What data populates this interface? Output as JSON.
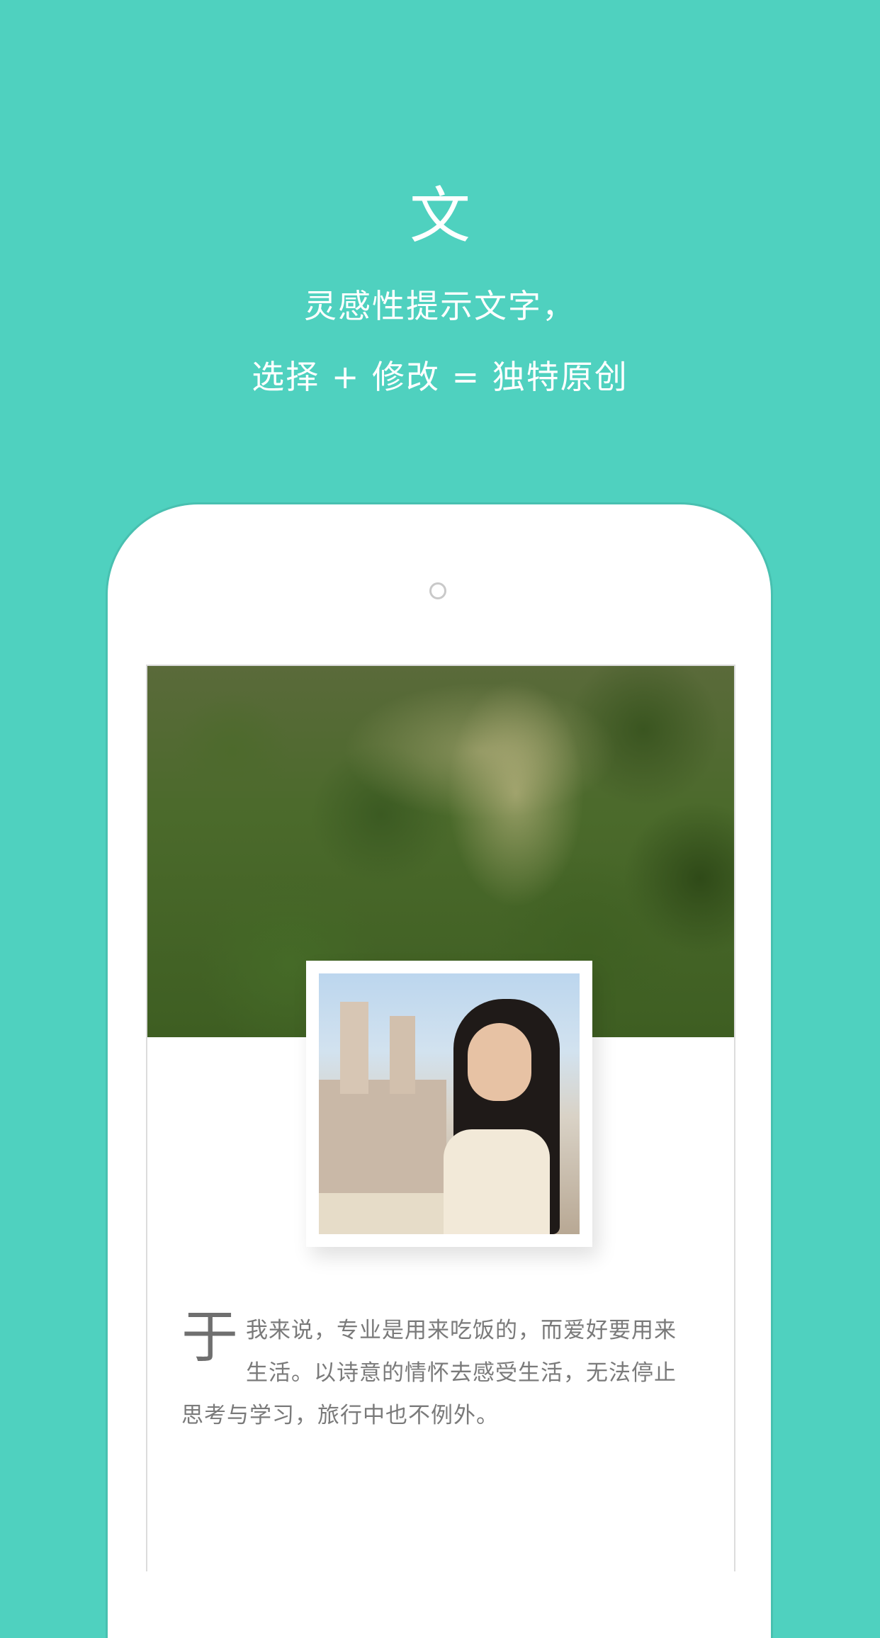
{
  "hero": {
    "title": "文",
    "line1": "灵感性提示文字，",
    "line2": "选择 + 修改 = 独特原创"
  },
  "story": {
    "drop_cap": "于",
    "text": "我来说，专业是用来吃饭的，而爱好要用来生活。以诗意的情怀去感受生活，无法停止思考与学习，旅行中也不例外。"
  },
  "colors": {
    "background": "#4fd1bf",
    "text_light": "#ffffff",
    "text_body": "#7a7a7a"
  }
}
